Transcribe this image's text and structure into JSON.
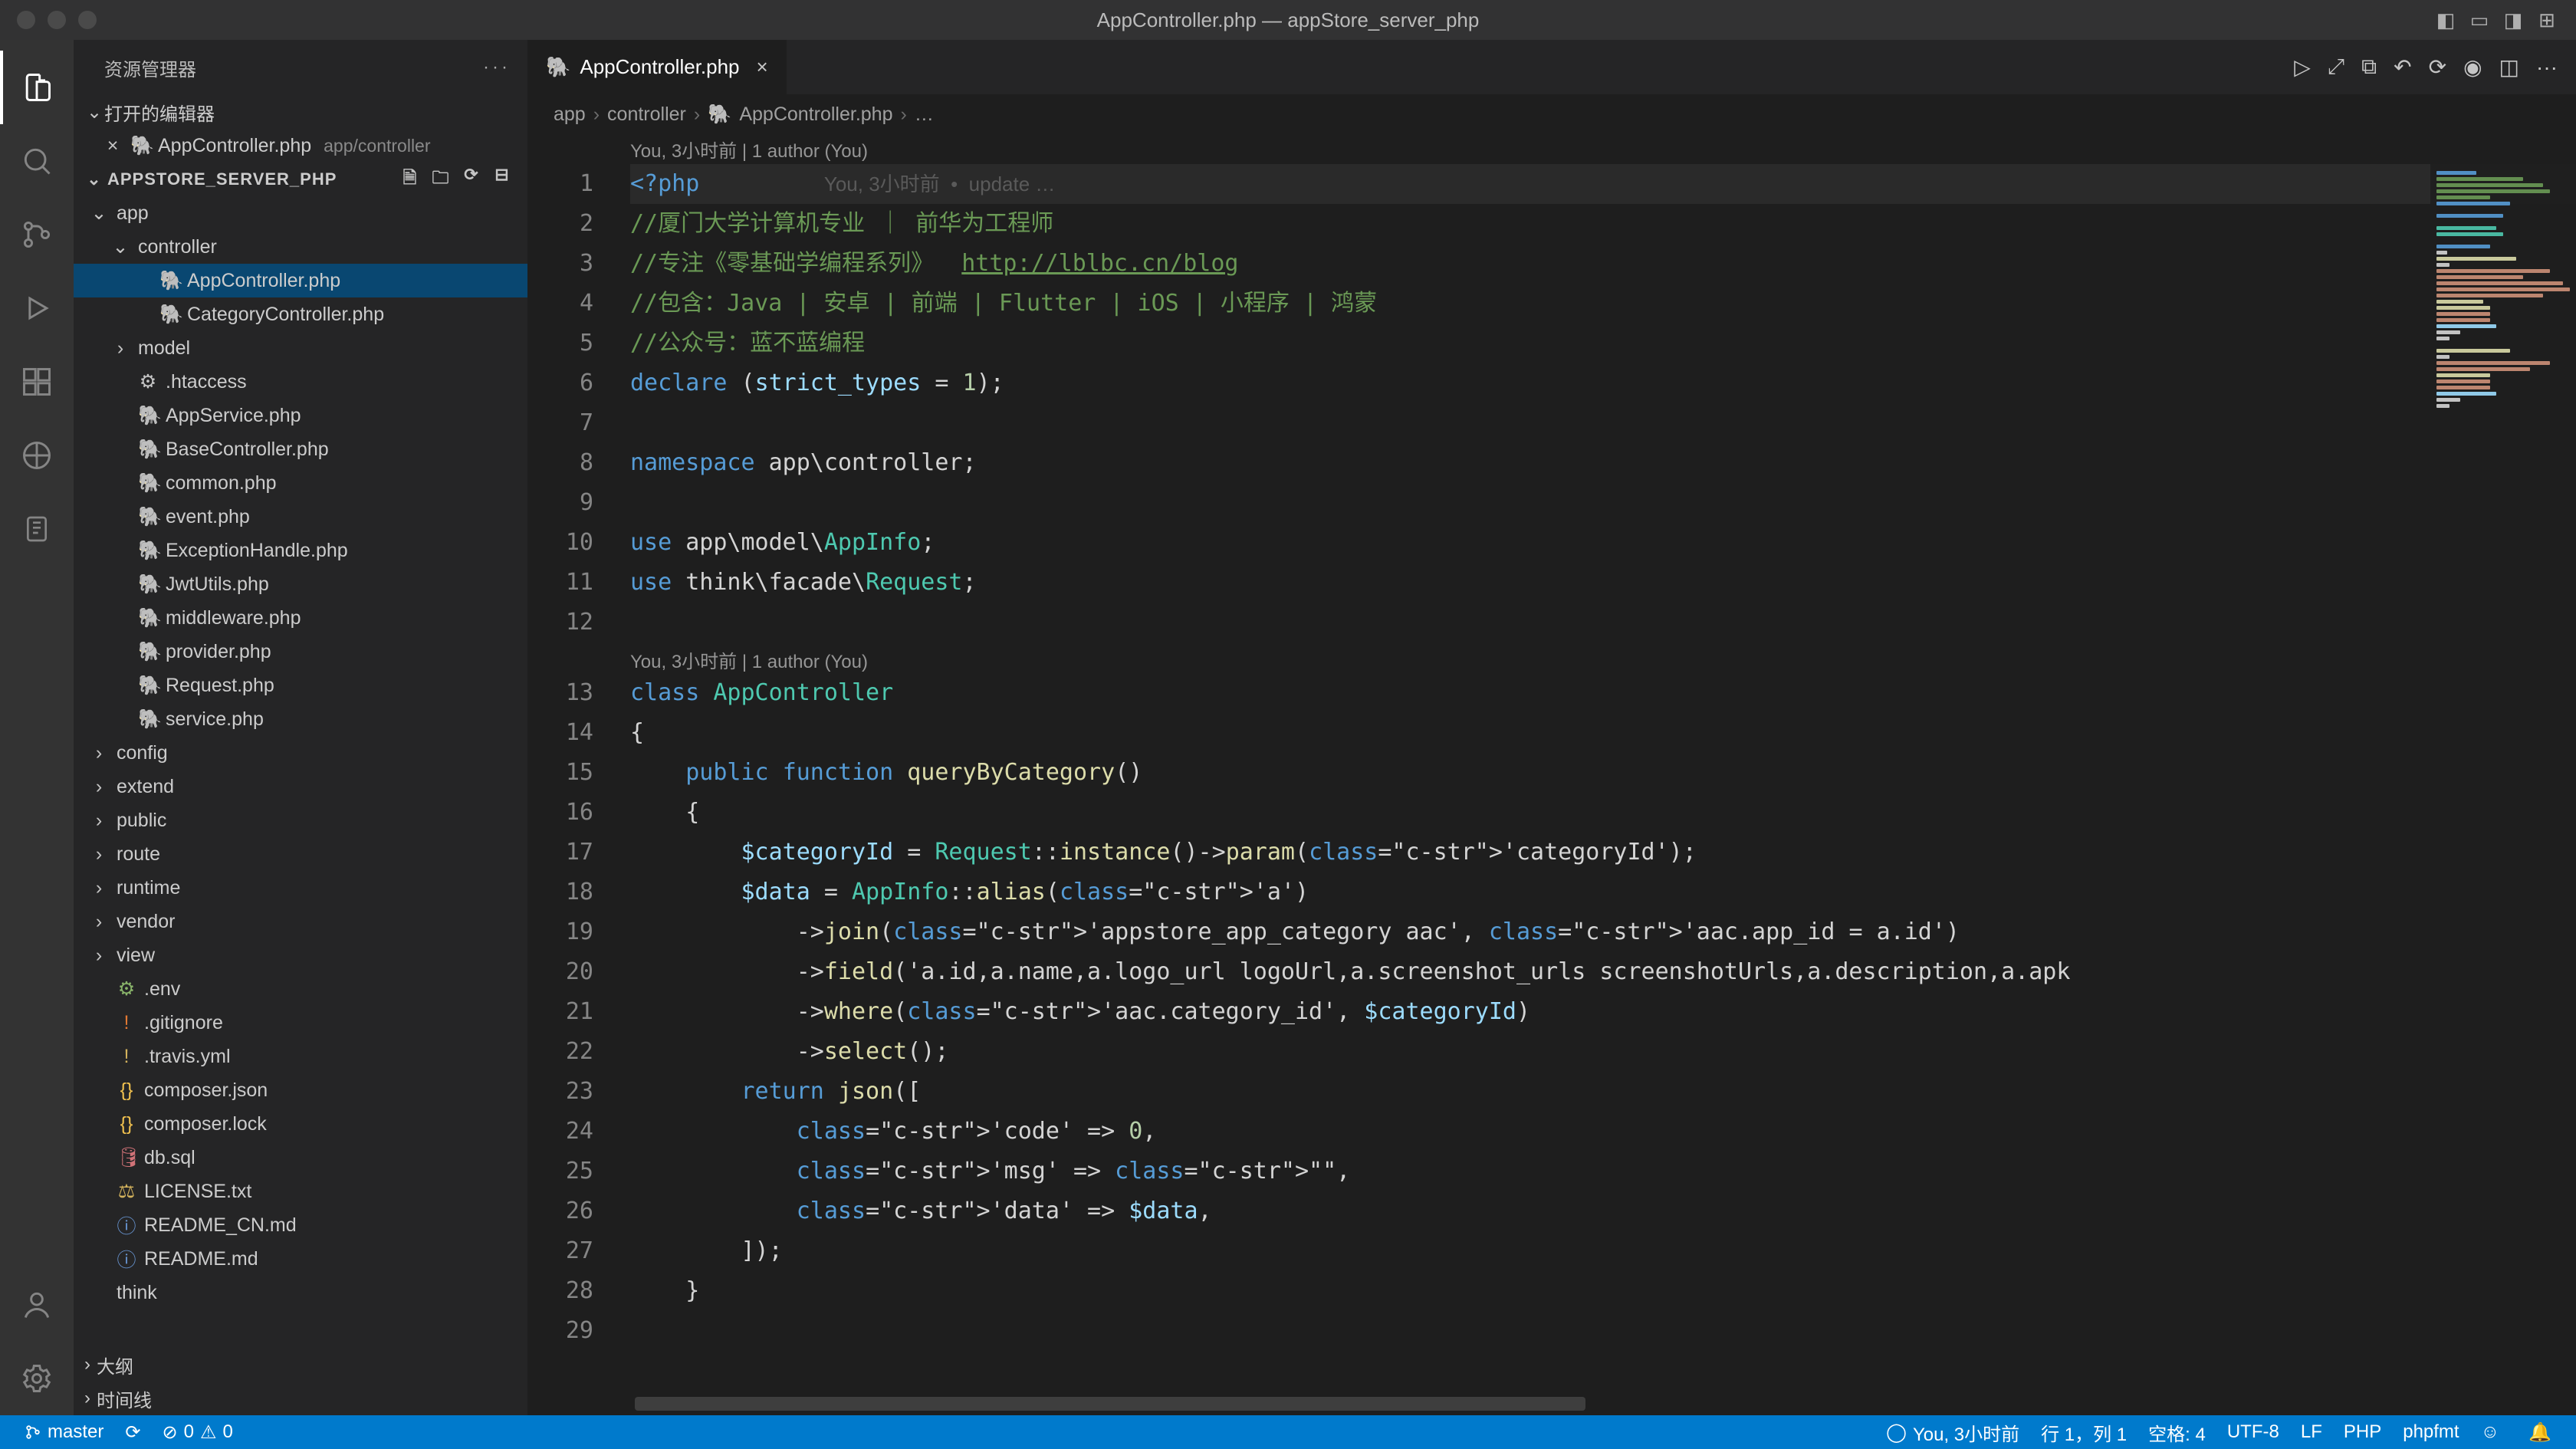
{
  "title": "AppController.php — appStore_server_php",
  "sidebar": {
    "title": "资源管理器",
    "openEditors": {
      "label": "打开的编辑器",
      "items": [
        {
          "name": "AppController.php",
          "hint": "app/controller"
        }
      ]
    },
    "project": {
      "name": "APPSTORE_SERVER_PHP"
    },
    "tree": [
      {
        "depth": 0,
        "chev": "⌄",
        "kind": "folder",
        "label": "app"
      },
      {
        "depth": 1,
        "chev": "⌄",
        "kind": "folder",
        "label": "controller"
      },
      {
        "depth": 2,
        "chev": "",
        "kind": "php",
        "label": "AppController.php",
        "selected": true
      },
      {
        "depth": 2,
        "chev": "",
        "kind": "php",
        "label": "CategoryController.php"
      },
      {
        "depth": 1,
        "chev": "›",
        "kind": "folder",
        "label": "model"
      },
      {
        "depth": 1,
        "chev": "",
        "kind": "gear",
        "label": ".htaccess"
      },
      {
        "depth": 1,
        "chev": "",
        "kind": "php",
        "label": "AppService.php"
      },
      {
        "depth": 1,
        "chev": "",
        "kind": "php",
        "label": "BaseController.php"
      },
      {
        "depth": 1,
        "chev": "",
        "kind": "php",
        "label": "common.php"
      },
      {
        "depth": 1,
        "chev": "",
        "kind": "php",
        "label": "event.php"
      },
      {
        "depth": 1,
        "chev": "",
        "kind": "php",
        "label": "ExceptionHandle.php"
      },
      {
        "depth": 1,
        "chev": "",
        "kind": "php",
        "label": "JwtUtils.php"
      },
      {
        "depth": 1,
        "chev": "",
        "kind": "php",
        "label": "middleware.php"
      },
      {
        "depth": 1,
        "chev": "",
        "kind": "php",
        "label": "provider.php"
      },
      {
        "depth": 1,
        "chev": "",
        "kind": "php",
        "label": "Request.php"
      },
      {
        "depth": 1,
        "chev": "",
        "kind": "php",
        "label": "service.php"
      },
      {
        "depth": 0,
        "chev": "›",
        "kind": "folder",
        "label": "config"
      },
      {
        "depth": 0,
        "chev": "›",
        "kind": "folder",
        "label": "extend"
      },
      {
        "depth": 0,
        "chev": "›",
        "kind": "folder",
        "label": "public"
      },
      {
        "depth": 0,
        "chev": "›",
        "kind": "folder",
        "label": "route"
      },
      {
        "depth": 0,
        "chev": "›",
        "kind": "folder",
        "label": "runtime"
      },
      {
        "depth": 0,
        "chev": "›",
        "kind": "folder",
        "label": "vendor"
      },
      {
        "depth": 0,
        "chev": "›",
        "kind": "folder",
        "label": "view"
      },
      {
        "depth": 0,
        "chev": "",
        "kind": "env",
        "label": ".env"
      },
      {
        "depth": 0,
        "chev": "",
        "kind": "git",
        "label": ".gitignore"
      },
      {
        "depth": 0,
        "chev": "",
        "kind": "ex",
        "label": ".travis.yml"
      },
      {
        "depth": 0,
        "chev": "",
        "kind": "json",
        "label": "composer.json"
      },
      {
        "depth": 0,
        "chev": "",
        "kind": "json",
        "label": "composer.lock"
      },
      {
        "depth": 0,
        "chev": "",
        "kind": "db",
        "label": "db.sql"
      },
      {
        "depth": 0,
        "chev": "",
        "kind": "lic",
        "label": "LICENSE.txt"
      },
      {
        "depth": 0,
        "chev": "",
        "kind": "md",
        "label": "README_CN.md"
      },
      {
        "depth": 0,
        "chev": "",
        "kind": "md",
        "label": "README.md"
      },
      {
        "depth": 0,
        "chev": "",
        "kind": "folder",
        "label": "think"
      }
    ],
    "outline": "大纲",
    "timeline": "时间线"
  },
  "editor": {
    "tab": {
      "label": "AppController.php"
    },
    "breadcrumbs": [
      "app",
      "controller",
      "AppController.php",
      "…"
    ],
    "codelens1": "You, 3小时前 | 1 author (You)",
    "codelens2": "You, 3小时前 | 1 author (You)",
    "blame": "You, 3小时前  •  update …",
    "lines": [
      "<?php",
      "//厦门大学计算机专业 ｜ 前华为工程师",
      "//专注《零基础学编程系列》  http://lblbc.cn/blog",
      "//包含：Java | 安卓 | 前端 | Flutter | iOS | 小程序 | 鸿蒙",
      "//公众号：蓝不蓝编程",
      "declare (strict_types = 1);",
      "",
      "namespace app\\controller;",
      "",
      "use app\\model\\AppInfo;",
      "use think\\facade\\Request;",
      "",
      "class AppController",
      "{",
      "    public function queryByCategory()",
      "    {",
      "        $categoryId = Request::instance()->param('categoryId');",
      "        $data = AppInfo::alias('a')",
      "            ->join('appstore_app_category aac', 'aac.app_id = a.id')",
      "            ->field('a.id,a.name,a.logo_url logoUrl,a.screenshot_urls screenshotUrls,a.description,a.apk",
      "            ->where('aac.category_id', $categoryId)",
      "            ->select();",
      "        return json([",
      "            'code' => 0,",
      "            'msg' => \"\",",
      "            'data' => $data,",
      "        ]);",
      "    }",
      ""
    ]
  },
  "status": {
    "branch": "master",
    "sync": "⟳",
    "errors": "0",
    "warnings": "0",
    "blame": "You, 3小时前",
    "lncol": "行 1，列 1",
    "spaces": "空格: 4",
    "encoding": "UTF-8",
    "eol": "LF",
    "lang": "PHP",
    "fmt": "phpfmt"
  }
}
